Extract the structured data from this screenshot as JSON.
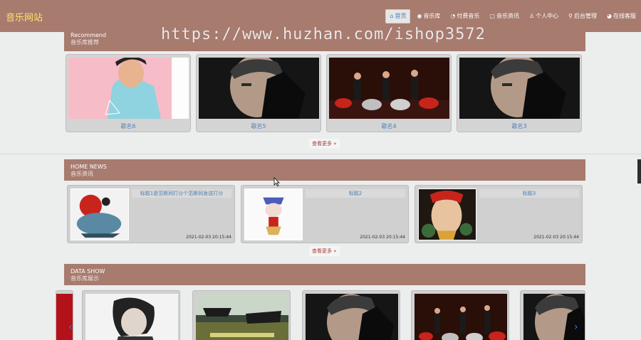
{
  "header": {
    "logo": "音乐网站",
    "watermark": "https://www.huzhan.com/ishop3572",
    "nav": [
      {
        "icon": "home-icon",
        "glyph": "⌂",
        "label": "首页",
        "active": true
      },
      {
        "icon": "music-library-icon",
        "glyph": "◉",
        "label": "音乐库",
        "active": false
      },
      {
        "icon": "paid-music-icon",
        "glyph": "◔",
        "label": "付费音乐",
        "active": false
      },
      {
        "icon": "news-icon",
        "glyph": "▢",
        "label": "音乐资讯",
        "active": false
      },
      {
        "icon": "user-icon",
        "glyph": "♙",
        "label": "个人中心",
        "active": false
      },
      {
        "icon": "admin-icon",
        "glyph": "⚲",
        "label": "后台管理",
        "active": false
      },
      {
        "icon": "support-icon",
        "glyph": "◕",
        "label": "在线客服",
        "active": false
      }
    ]
  },
  "recommend": {
    "title_en": "Recommend",
    "title_cn": "音乐库推荐",
    "items": [
      {
        "name": "歌名6"
      },
      {
        "name": "歌名5"
      },
      {
        "name": "歌名4"
      },
      {
        "name": "歌名3"
      }
    ],
    "more": "查看更多 »"
  },
  "news": {
    "title_en": "HOME NEWS",
    "title_cn": "音乐资讯",
    "items": [
      {
        "title": "标题1是范斯同打分个范斯同发送打分",
        "date": "2021-02-03 20:15:44"
      },
      {
        "title": "标题2",
        "date": "2021-02-03 20:15:44"
      },
      {
        "title": "标题3",
        "date": "2021-02-03 20:15:44"
      }
    ],
    "more": "查看更多 »"
  },
  "datashow": {
    "title_en": "DATA SHOW",
    "title_cn": "音乐库展示",
    "prev": "‹",
    "next": "›"
  },
  "colors": {
    "header_bg": "#a77b6e",
    "logo": "#fde36a",
    "link": "#4a7fb5",
    "more": "#a33a3a"
  }
}
